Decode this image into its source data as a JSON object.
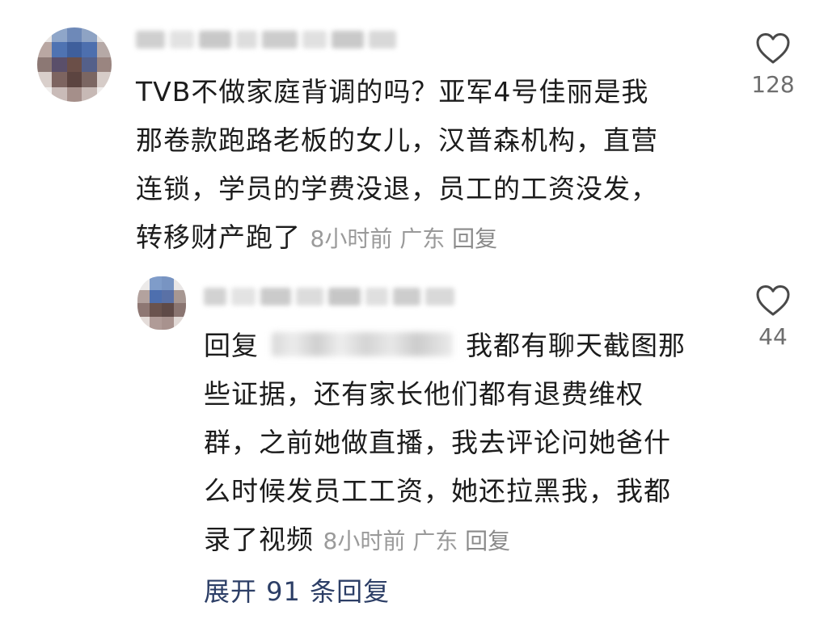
{
  "comment": {
    "text_lines": [
      "TVB不做家庭背调的吗？亚军4号佳丽是我",
      "那卷款跑路老板的女儿，汉普森机构，直营",
      "连锁，学员的学费没退，员工的工资没发，",
      "转移财产跑了"
    ],
    "time": "8小时前",
    "location": "广东",
    "reply_label": "回复",
    "like_count": "128"
  },
  "reply": {
    "prefix": "回复",
    "text_first": "我都有聊天截图那",
    "text_lines": [
      "些证据，还有家长他们都有退费维权",
      "群，之前她做直播，我去评论问她爸什",
      "么时候发员工工资，她还拉黑我，我都",
      "录了视频"
    ],
    "time": "8小时前",
    "location": "广东",
    "reply_label": "回复",
    "like_count": "44"
  },
  "expand_label": "展开 91 条回复",
  "icons": {
    "like": "heart-outline-icon"
  },
  "colors": {
    "text": "#1c1c1c",
    "meta": "#9a9a9a",
    "link": "#2c3e66"
  }
}
